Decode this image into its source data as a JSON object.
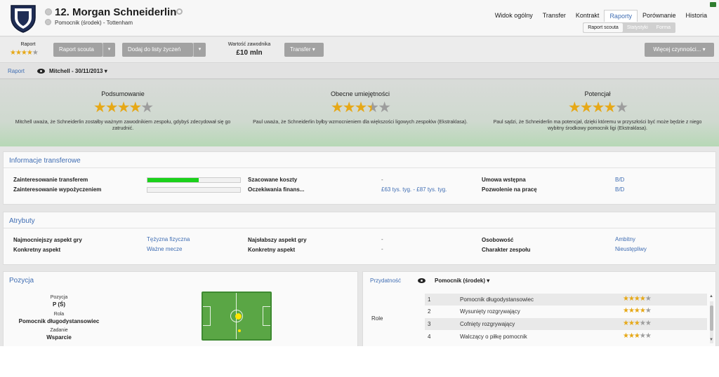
{
  "header": {
    "player_name": "12. Morgan Schneiderlin",
    "player_sub": "Pomocnik (środek) - Tottenham",
    "nav": [
      {
        "label": "Widok ogólny"
      },
      {
        "label": "Transfer"
      },
      {
        "label": "Kontrakt"
      },
      {
        "label": "Raporty"
      },
      {
        "label": "Porównanie"
      },
      {
        "label": "Historia"
      }
    ],
    "active_nav": "Raporty",
    "subnav": [
      {
        "label": "Raport scouta"
      },
      {
        "label": "Statystyki"
      },
      {
        "label": "Forma"
      }
    ]
  },
  "toolbar": {
    "report_label": "Raport",
    "report_stars": "★★★★",
    "report_stars_grey": "★",
    "scout_report_btn": "Raport scouta",
    "add_to_list_btn": "Dodaj do listy życzeń",
    "value_label": "Wartość zawodnika",
    "value": "£10 mln",
    "transfer_btn": "Transfer",
    "more_actions_btn": "Więcej czynności...",
    "caret": "▾"
  },
  "report": {
    "tab_label": "Raport",
    "scout": "Mitchell - 30/11/2013",
    "caret": "▾",
    "columns": [
      {
        "title": "Podsumowanie",
        "stars": "★★★★",
        "stars_grey": "★",
        "text": "Mitchell uważa, że Schneiderlin zostałby ważnym zawodnikiem zespołu, gdybyś zdecydował się go zatrudnić."
      },
      {
        "title": "Obecne umiejętności",
        "stars": "★★★",
        "stars_half": "★",
        "stars_grey": "★",
        "text": "Paul uważa, że Schneiderlin byłby wzmocnieniem dla większości ligowych zespołów (Ekstraklasa)."
      },
      {
        "title": "Potencjał",
        "stars": "★★★★",
        "stars_grey": "★",
        "text": "Paul sądzi, że Schneiderlin ma potencjał, dzięki któremu w przyszłości być może będzie z niego wybitny środkowy pomocnik ligi (Ekstraklasa)."
      }
    ],
    "ratings": {
      "summary": 4,
      "current_ability": 3.5,
      "potential": 4
    }
  },
  "transfer_info": {
    "title": "Informacje transferowe",
    "interest_transfer_label": "Zainteresowanie transferem",
    "interest_transfer_level": 0.55,
    "interest_loan_label": "Zainteresowanie wypożyczeniem",
    "interest_loan_level": 0,
    "est_cost_label": "Szacowane koszty",
    "est_cost_value": "-",
    "wage_expect_label": "Oczekiwania finans...",
    "wage_expect_value": "£63 tys. tyg. - £87 tys. tyg.",
    "pre_contract_label": "Umowa wstępna",
    "pre_contract_value": "B/D",
    "work_permit_label": "Pozwolenie na pracę",
    "work_permit_value": "B/D"
  },
  "attributes": {
    "title": "Atrybuty",
    "strongest_label": "Najmocniejszy aspekt gry",
    "strongest_value": "Tężyzna fizyczna",
    "specific_label": "Konkretny aspekt",
    "specific_value": "Ważne mecze",
    "weakest_label": "Najsłabszy aspekt gry",
    "weakest_value": "-",
    "specific2_label": "Konkretny aspekt",
    "specific2_value": "-",
    "personality_label": "Osobowość",
    "personality_value": "Ambitny",
    "team_char_label": "Charakter zespołu",
    "team_char_value": "Nieustępliwy"
  },
  "position": {
    "title": "Pozycja",
    "pos_label": "Pozycja",
    "pos_value": "P (Ś)",
    "role_label": "Rola",
    "role_value": "Pomocnik długodystansowiec",
    "duty_label": "Zadanie",
    "duty_value": "Wsparcie"
  },
  "suitability": {
    "tab_label": "Przydatność",
    "selected": "Pomocnik (środek)",
    "caret": "▾",
    "role_label": "Role",
    "roles": [
      {
        "num": "1",
        "name": "Pomocnik długodystansowiec",
        "stars": "★★★★",
        "grey": "★"
      },
      {
        "num": "2",
        "name": "Wysunięty rozgrywający",
        "stars": "★★★★",
        "grey": "★"
      },
      {
        "num": "3",
        "name": "Cofnięty rozgrywający",
        "stars": "★★★",
        "grey": "★★"
      },
      {
        "num": "4",
        "name": "Walczący o piłkę pomocnik",
        "stars": "★★★",
        "grey": "★★"
      }
    ],
    "role_ratings": [
      4,
      4,
      3,
      3
    ]
  },
  "colors": {
    "accent": "#3f6db3",
    "star": "#e6a817",
    "interest_bar": "#1bd11b"
  }
}
